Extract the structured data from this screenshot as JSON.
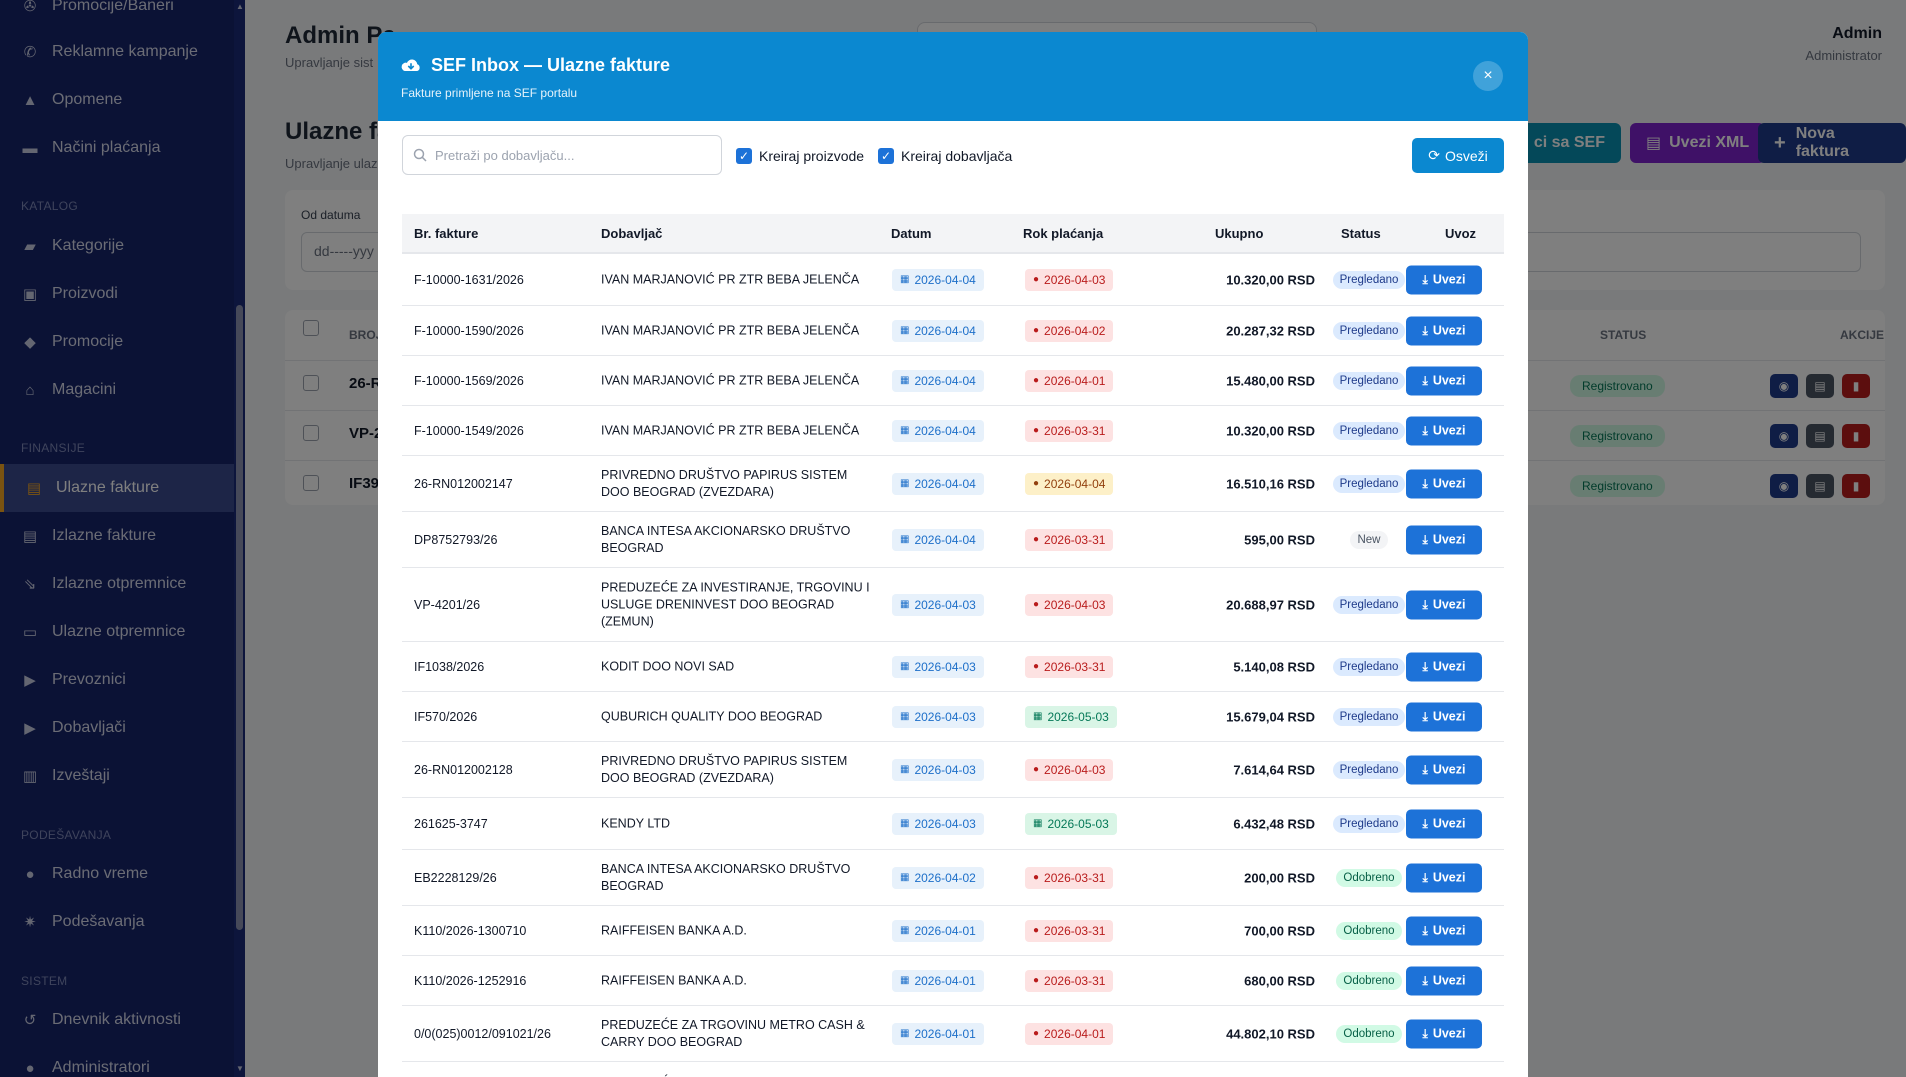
{
  "sidebar": {
    "items_top": [
      {
        "label": "Promocije/Baneri",
        "icon": "bullhorn-icon"
      },
      {
        "label": "Reklamne kampanje",
        "icon": "megaphone-icon"
      },
      {
        "label": "Opomene",
        "icon": "warning-icon"
      },
      {
        "label": "Načini plaćanja",
        "icon": "credit-card-icon"
      }
    ],
    "section_katalog": "KATALOG",
    "items_katalog": [
      {
        "label": "Kategorije",
        "icon": "folder-icon"
      },
      {
        "label": "Proizvodi",
        "icon": "box-icon"
      },
      {
        "label": "Promocije",
        "icon": "tag-icon"
      },
      {
        "label": "Magacini",
        "icon": "warehouse-icon"
      }
    ],
    "section_finansije": "FINANSIJE",
    "items_finansije": [
      {
        "label": "Ulazne fakture",
        "icon": "file-invoice-icon",
        "active": true
      },
      {
        "label": "Izlazne fakture",
        "icon": "file-icon"
      },
      {
        "label": "Izlazne otpremnice",
        "icon": "dolly-icon"
      },
      {
        "label": "Ulazne otpremnice",
        "icon": "inbox-icon"
      },
      {
        "label": "Prevoznici",
        "icon": "truck-icon"
      },
      {
        "label": "Dobavljači",
        "icon": "truck-loading-icon"
      },
      {
        "label": "Izveštaji",
        "icon": "chart-icon"
      }
    ],
    "section_podesavanja": "PODEŠAVANJA",
    "items_podesavanja": [
      {
        "label": "Radno vreme",
        "icon": "clock-icon"
      },
      {
        "label": "Podešavanja",
        "icon": "gear-icon"
      }
    ],
    "section_sistem": "SISTEM",
    "items_sistem": [
      {
        "label": "Dnevnik aktivnosti",
        "icon": "history-icon"
      },
      {
        "label": "Administratori",
        "icon": "user-icon"
      }
    ]
  },
  "page": {
    "title": "Admin Pa",
    "subtitle": "Upravljanje sist",
    "user_name": "Admin",
    "user_role": "Administrator",
    "section_title": "Ulazne fa",
    "section_subtitle": "Upravljanje ulaz",
    "btn_sync": "ci sa SEF",
    "btn_import_xml": "Uvezi XML",
    "btn_new": "Nova faktura",
    "filter_label": "Od datuma",
    "filter_placeholder": "dd-----yyy",
    "col_broj": "BROJ",
    "col_status": "STATUS",
    "col_akcije": "AKCIJE",
    "rows": [
      {
        "num": "26-R",
        "status": "Registrovano"
      },
      {
        "num": "VP-2",
        "status": "Registrovano"
      },
      {
        "num": "IF39",
        "status": "Registrovano"
      }
    ]
  },
  "modal": {
    "title": "SEF Inbox — Ulazne fakture",
    "subtitle": "Fakture primljene na SEF portalu",
    "close": "×",
    "search_placeholder": "Pretraži po dobavljaču...",
    "chk_products": "Kreiraj proizvode",
    "chk_suppliers": "Kreiraj dobavljača",
    "refresh": "Osveži",
    "columns": [
      "Br. fakture",
      "Dobavljač",
      "Datum",
      "Rok plaćanja",
      "Ukupno",
      "Status",
      "Uvoz"
    ],
    "action_label": "Uvezi",
    "rows": [
      {
        "num": "F-10000-1631/2026",
        "supplier": "IVAN MARJANOVIĆ PR ZTR BEBA JELENČA",
        "date": "2026-04-04",
        "due": "2026-04-03",
        "due_state": "overdue",
        "total": "10.320,00 RSD",
        "status": "Pregledano"
      },
      {
        "num": "F-10000-1590/2026",
        "supplier": "IVAN MARJANOVIĆ PR ZTR BEBA JELENČA",
        "date": "2026-04-04",
        "due": "2026-04-02",
        "due_state": "overdue",
        "total": "20.287,32 RSD",
        "status": "Pregledano"
      },
      {
        "num": "F-10000-1569/2026",
        "supplier": "IVAN MARJANOVIĆ PR ZTR BEBA JELENČA",
        "date": "2026-04-04",
        "due": "2026-04-01",
        "due_state": "overdue",
        "total": "15.480,00 RSD",
        "status": "Pregledano"
      },
      {
        "num": "F-10000-1549/2026",
        "supplier": "IVAN MARJANOVIĆ PR ZTR BEBA JELENČA",
        "date": "2026-04-04",
        "due": "2026-03-31",
        "due_state": "overdue",
        "total": "10.320,00 RSD",
        "status": "Pregledano"
      },
      {
        "num": "26-RN012002147",
        "supplier": "PRIVREDNO DRUŠTVO PAPIRUS SISTEM DOO BEOGRAD (ZVEZDARA)",
        "date": "2026-04-04",
        "due": "2026-04-04",
        "due_state": "today",
        "total": "16.510,16 RSD",
        "status": "Pregledano"
      },
      {
        "num": "DP8752793/26",
        "supplier": "BANCA INTESA AKCIONARSKO DRUŠTVO BEOGRAD",
        "date": "2026-04-04",
        "due": "2026-03-31",
        "due_state": "overdue",
        "total": "595,00 RSD",
        "status": "New"
      },
      {
        "num": "VP-4201/26",
        "supplier": "PREDUZEĆE ZA INVESTIRANJE, TRGOVINU I USLUGE DRENINVEST DOO BEOGRAD (ZEMUN)",
        "date": "2026-04-03",
        "due": "2026-04-03",
        "due_state": "overdue",
        "total": "20.688,97 RSD",
        "status": "Pregledano"
      },
      {
        "num": "IF1038/2026",
        "supplier": "KODIT DOO NOVI SAD",
        "date": "2026-04-03",
        "due": "2026-03-31",
        "due_state": "overdue",
        "total": "5.140,08 RSD",
        "status": "Pregledano"
      },
      {
        "num": "IF570/2026",
        "supplier": "QUBURICH QUALITY DOO BEOGRAD",
        "date": "2026-04-03",
        "due": "2026-05-03",
        "due_state": "upcoming",
        "total": "15.679,04 RSD",
        "status": "Pregledano"
      },
      {
        "num": "26-RN012002128",
        "supplier": "PRIVREDNO DRUŠTVO PAPIRUS SISTEM DOO BEOGRAD (ZVEZDARA)",
        "date": "2026-04-03",
        "due": "2026-04-03",
        "due_state": "overdue",
        "total": "7.614,64 RSD",
        "status": "Pregledano"
      },
      {
        "num": "261625-3747",
        "supplier": "KENDY LTD",
        "date": "2026-04-03",
        "due": "2026-05-03",
        "due_state": "upcoming",
        "total": "6.432,48 RSD",
        "status": "Pregledano"
      },
      {
        "num": "EB2228129/26",
        "supplier": "BANCA INTESA AKCIONARSKO DRUŠTVO BEOGRAD",
        "date": "2026-04-02",
        "due": "2026-03-31",
        "due_state": "overdue",
        "total": "200,00 RSD",
        "status": "Odobreno"
      },
      {
        "num": "K110/2026-1300710",
        "supplier": "RAIFFEISEN BANKA A.D.",
        "date": "2026-04-01",
        "due": "2026-03-31",
        "due_state": "overdue",
        "total": "700,00 RSD",
        "status": "Odobreno"
      },
      {
        "num": "K110/2026-1252916",
        "supplier": "RAIFFEISEN BANKA A.D.",
        "date": "2026-04-01",
        "due": "2026-03-31",
        "due_state": "overdue",
        "total": "680,00 RSD",
        "status": "Odobreno"
      },
      {
        "num": "0/0(025)0012/091021/26",
        "supplier": "PREDUZEĆE ZA TRGOVINU METRO CASH & CARRY DOO BEOGRAD",
        "date": "2026-04-01",
        "due": "2026-04-01",
        "due_state": "overdue",
        "total": "44.802,10 RSD",
        "status": "Odobreno"
      },
      {
        "num": "",
        "supplier": "PREDUZEĆE ZA INVESTIRANJE, TRGOVINU",
        "date": "",
        "due": "",
        "due_state": "",
        "total": "",
        "status": ""
      }
    ]
  }
}
